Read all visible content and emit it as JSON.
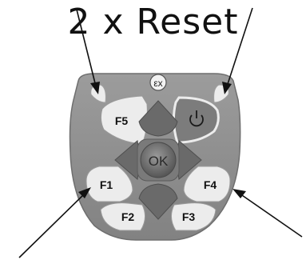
{
  "title": "2 x Reset",
  "keys": {
    "f1": "F1",
    "f2": "F2",
    "f3": "F3",
    "f4": "F4",
    "f5": "F5",
    "ok": "OK"
  },
  "ex_symbol": "εx",
  "power_icon": "power-icon",
  "colors": {
    "keypad": "#8f8f8f",
    "key_light": "#ececec",
    "key_dark": "#6c6c6c",
    "power_key": "#7a7a7a",
    "text": "#111111"
  }
}
